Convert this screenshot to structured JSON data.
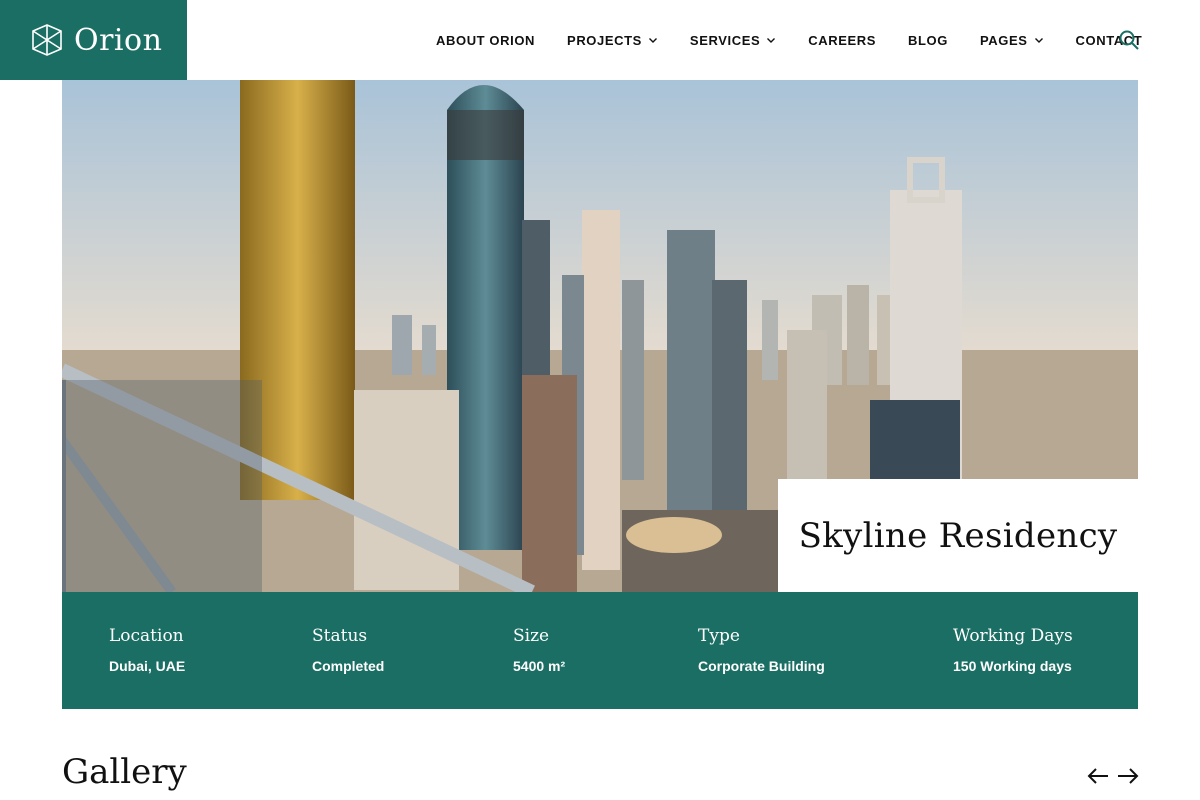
{
  "brand": {
    "name": "Orion",
    "color": "#1b6e63"
  },
  "nav": {
    "items": [
      {
        "label": "ABOUT ORION",
        "dropdown": false
      },
      {
        "label": "PROJECTS",
        "dropdown": true
      },
      {
        "label": "SERVICES",
        "dropdown": true
      },
      {
        "label": "CAREERS",
        "dropdown": false
      },
      {
        "label": "BLOG",
        "dropdown": false
      },
      {
        "label": "PAGES",
        "dropdown": true
      },
      {
        "label": "CONTACT",
        "dropdown": false
      }
    ],
    "search_icon": "search-icon"
  },
  "project": {
    "title": "Skyline Residency",
    "details": [
      {
        "label": "Location",
        "value": "Dubai, UAE"
      },
      {
        "label": "Status",
        "value": "Completed"
      },
      {
        "label": "Size",
        "value": "5400 m²"
      },
      {
        "label": "Type",
        "value": "Corporate Building"
      },
      {
        "label": "Working Days",
        "value": "150 Working days"
      }
    ]
  },
  "gallery": {
    "title": "Gallery",
    "prev_icon": "arrow-left-icon",
    "next_icon": "arrow-right-icon"
  }
}
